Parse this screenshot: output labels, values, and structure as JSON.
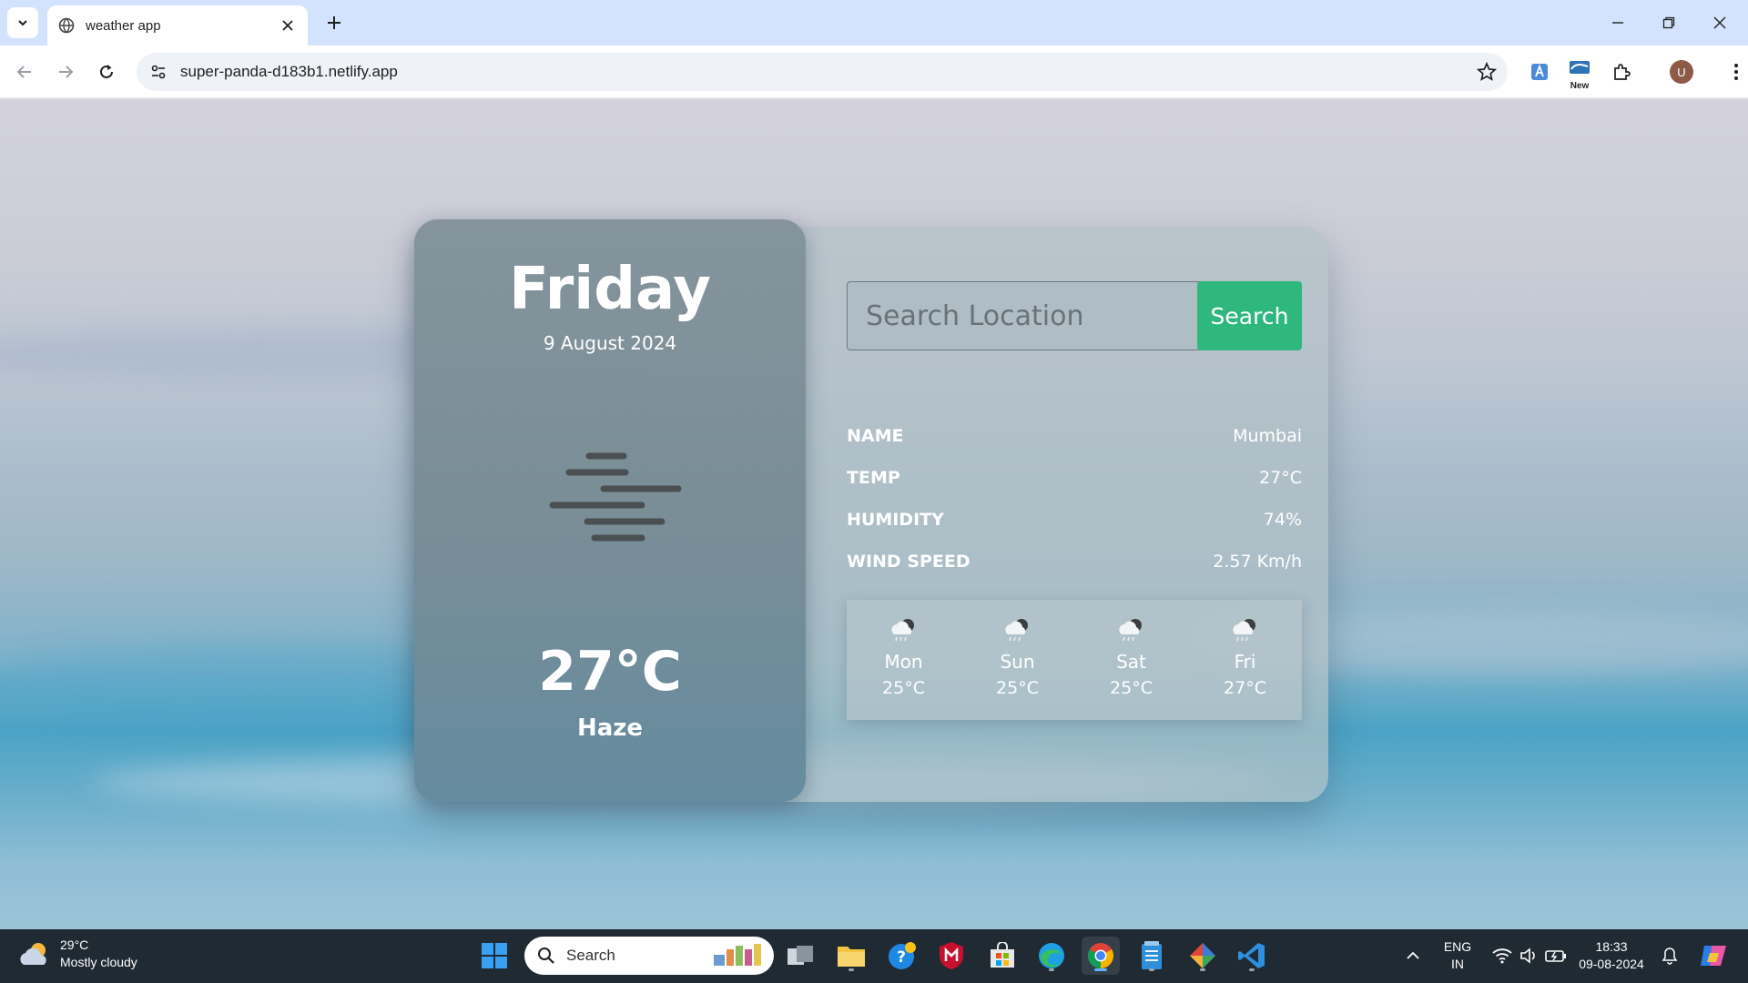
{
  "browser": {
    "tab_title": "weather app",
    "url": "super-panda-d183b1.netlify.app",
    "ext_new_label": "New",
    "avatar_letter": "U"
  },
  "weather": {
    "day": "Friday",
    "date": "9 August 2024",
    "temperature": "27°C",
    "condition": "Haze",
    "icon": "haze-icon",
    "search": {
      "placeholder": "Search Location",
      "button_label": "Search"
    },
    "details": [
      {
        "label": "NAME",
        "value": "Mumbai"
      },
      {
        "label": "TEMP",
        "value": "27°C"
      },
      {
        "label": "HUMIDITY",
        "value": "74%"
      },
      {
        "label": "WIND SPEED",
        "value": "2.57 Km/h"
      }
    ],
    "forecast": [
      {
        "day": "Mon",
        "temp": "25°C",
        "icon": "rain-cloud-icon"
      },
      {
        "day": "Sun",
        "temp": "25°C",
        "icon": "rain-cloud-icon"
      },
      {
        "day": "Sat",
        "temp": "25°C",
        "icon": "rain-cloud-icon"
      },
      {
        "day": "Fri",
        "temp": "27°C",
        "icon": "rain-cloud-icon"
      }
    ]
  },
  "taskbar": {
    "weather_temp": "29°C",
    "weather_desc": "Mostly cloudy",
    "search_label": "Search",
    "lang_top": "ENG",
    "lang_bottom": "IN",
    "time": "18:33",
    "date": "09-08-2024"
  },
  "colors": {
    "accent_green": "#2fb87e",
    "tab_bar": "#d3e3fd",
    "taskbar": "#1f2a33"
  }
}
